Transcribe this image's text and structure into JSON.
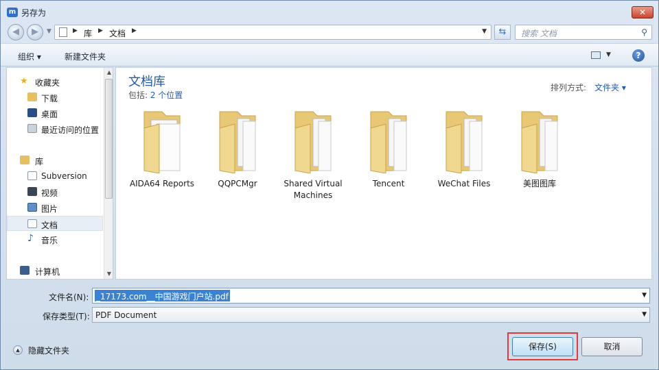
{
  "window": {
    "title": "另存为",
    "close_label": "✕"
  },
  "nav": {
    "breadcrumb": [
      "库",
      "文档"
    ],
    "search_placeholder": "搜索 文档"
  },
  "toolbar": {
    "organize_label": "组织 ▾",
    "new_folder_label": "新建文件夹"
  },
  "sidebar": {
    "favorites": {
      "label": "收藏夹",
      "items": [
        "下载",
        "桌面",
        "最近访问的位置"
      ]
    },
    "libraries": {
      "label": "库",
      "items": [
        "Subversion",
        "视频",
        "图片",
        "文档",
        "音乐"
      ]
    },
    "computer": {
      "label": "计算机"
    }
  },
  "content": {
    "title": "文档库",
    "includes_prefix": "包括: ",
    "includes_link": "2 个位置",
    "arrange_label": "排列方式:",
    "arrange_value": "文件夹 ▾",
    "folders": [
      "AIDA64 Reports",
      "QQPCMgr",
      "Shared Virtual Machines",
      "Tencent",
      "WeChat Files",
      "美图图库"
    ]
  },
  "form": {
    "filename_label": "文件名(N):",
    "filename_value": "_17173.com__中国游戏门户站.pdf",
    "filetype_label": "保存类型(T):",
    "filetype_value": "PDF Document"
  },
  "footer": {
    "hide_folders_label": "隐藏文件夹",
    "save_label": "保存(S)",
    "cancel_label": "取消"
  }
}
